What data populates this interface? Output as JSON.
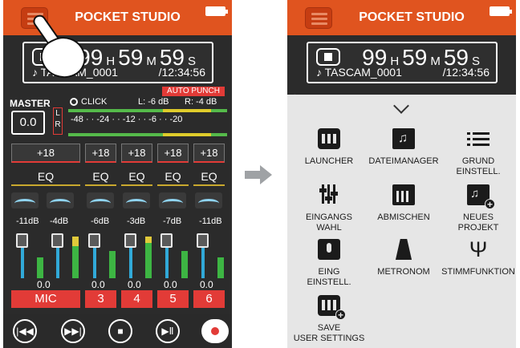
{
  "app": {
    "title": "POCKET STUDIO"
  },
  "counter": {
    "hours": "99",
    "hours_unit": "H",
    "minutes": "59",
    "minutes_unit": "M",
    "seconds": "59",
    "seconds_unit": "S",
    "filename": "♪ TASCAM_0001",
    "total": "/12:34:56"
  },
  "mixer": {
    "auto_punch": "AUTO PUNCH",
    "master_label": "MASTER",
    "master_value": "0.0",
    "lr_label": "L\nR",
    "click_label": "CLICK",
    "peak_left": "L:  -6 dB",
    "peak_right": "R:  -4 dB",
    "scale": "-48 · · -24 · · -12 · · -6 · · -20",
    "gains": [
      "+18",
      "+18",
      "+18",
      "+18",
      "+18"
    ],
    "eq_label": "EQ",
    "levels": [
      "-11dB",
      "-4dB",
      "-6dB",
      "-3dB",
      "-7dB",
      "-11dB"
    ],
    "values": [
      "0.0",
      "0.0",
      "0.0",
      "0.0",
      "0.0"
    ],
    "channels": [
      "MIC",
      "3",
      "4",
      "5",
      "6"
    ]
  },
  "menu": {
    "ghost_text": "○ · · · · ·  ·  ·  ·",
    "items": [
      {
        "label": "LAUNCHER",
        "icon": "grid-icon"
      },
      {
        "label": "DATEIMANAGER",
        "icon": "music-folder-icon"
      },
      {
        "label": "GRUND\nEINSTELL.",
        "icon": "list-icon"
      },
      {
        "label": "EINGANGS\nWAHL",
        "icon": "input-fader-icon"
      },
      {
        "label": "ABMISCHEN",
        "icon": "mix-icon"
      },
      {
        "label": "NEUES\nPROJEKT",
        "icon": "new-project-icon"
      },
      {
        "label": "EING\nEINSTELL.",
        "icon": "microphone-icon"
      },
      {
        "label": "METRONOM",
        "icon": "metronome-icon"
      },
      {
        "label": "STIMMFUNKTION",
        "icon": "tuner-icon"
      },
      {
        "label": "SAVE\nUSER SETTINGS",
        "icon": "save-user-settings-icon"
      }
    ]
  }
}
